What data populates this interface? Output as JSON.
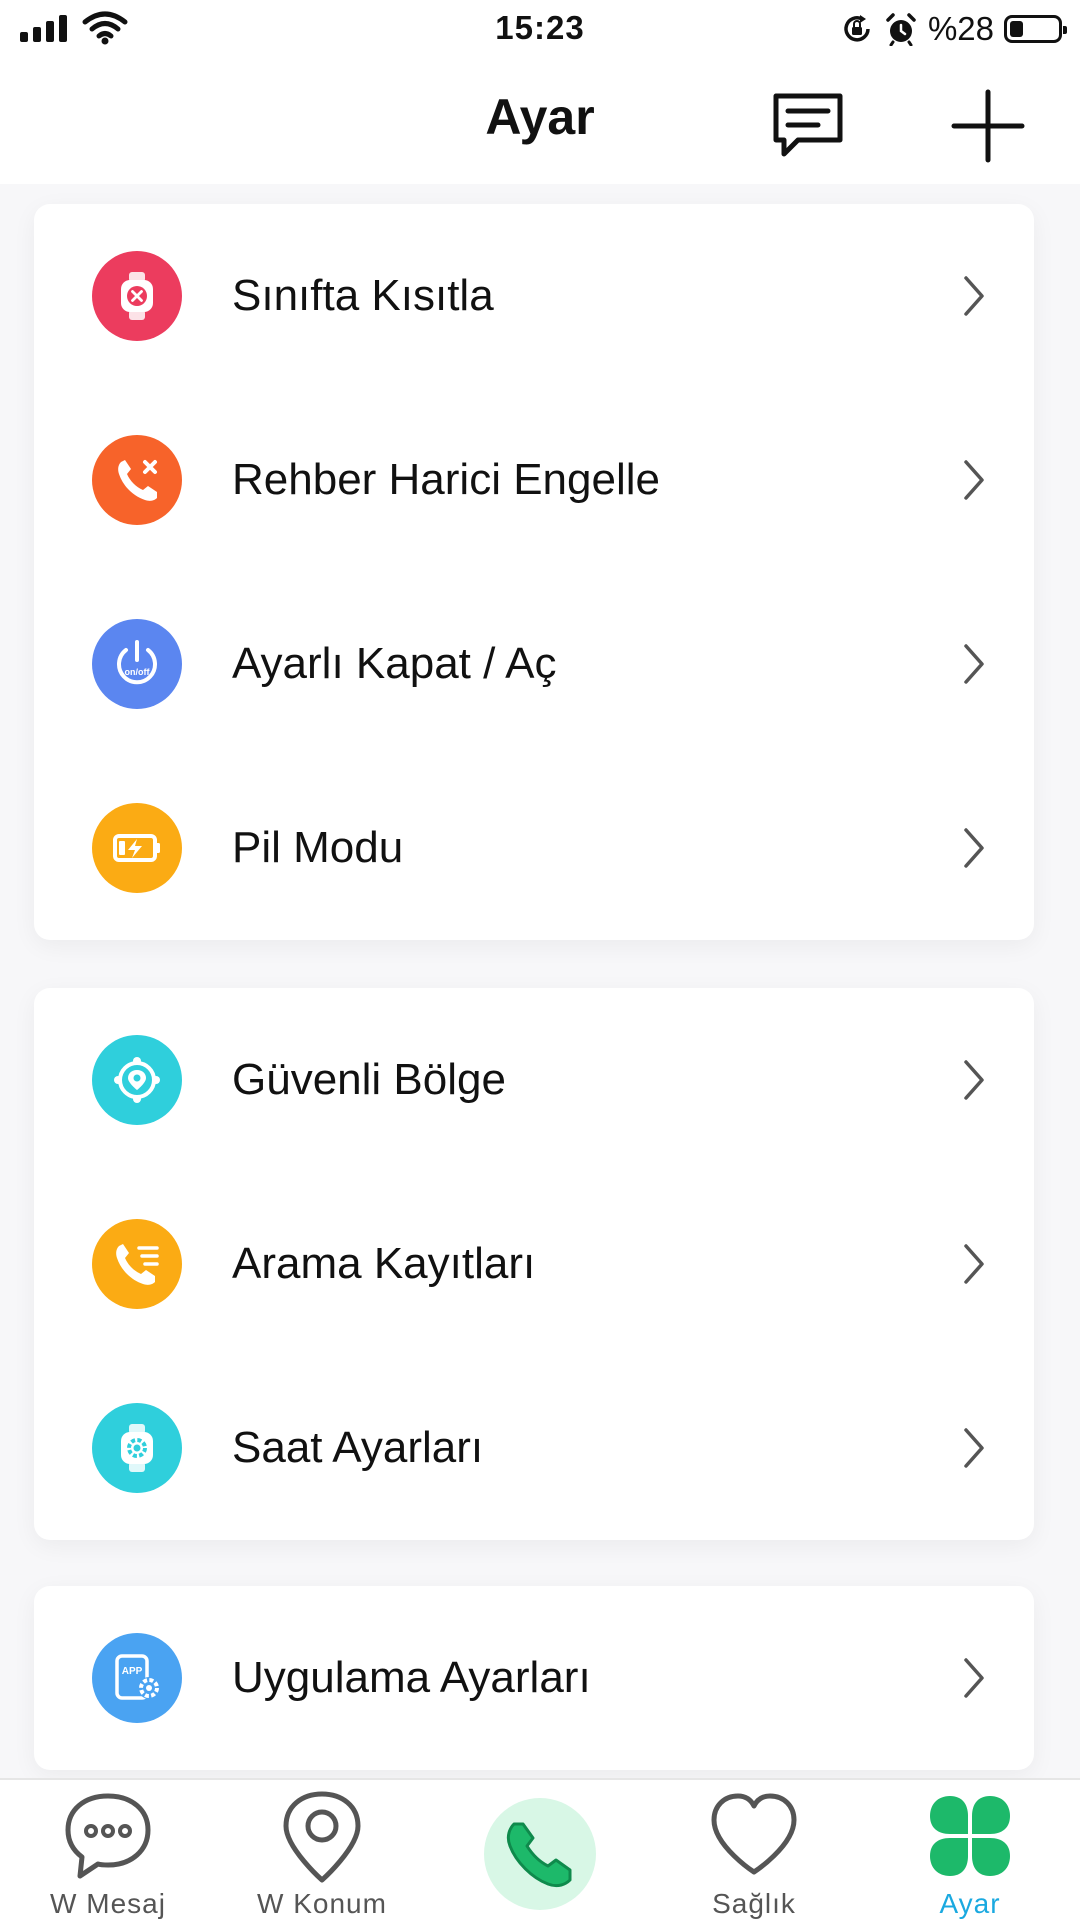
{
  "status_bar": {
    "time": "15:23",
    "battery": "%28",
    "battery_level": 0.28,
    "icons": [
      "signal-icon",
      "wifi-icon",
      "orientation-lock-icon",
      "alarm-icon",
      "battery-icon"
    ]
  },
  "header": {
    "title": "Ayar",
    "icons": [
      "message-icon",
      "plus-icon"
    ]
  },
  "groups": [
    {
      "items": [
        {
          "label": "Sınıfta Kısıtla",
          "icon": "watch-block-icon",
          "color": "#ec3c5e"
        },
        {
          "label": "Rehber Harici Engelle",
          "icon": "call-block-icon",
          "color": "#f7632a"
        },
        {
          "label": "Ayarlı Kapat / Aç",
          "icon": "power-icon",
          "color": "#5b86f0",
          "icon_text": "on/off"
        },
        {
          "label": "Pil Modu",
          "icon": "battery-charge-icon",
          "color": "#fbab14"
        }
      ]
    },
    {
      "items": [
        {
          "label": "Güvenli Bölge",
          "icon": "safe-zone-icon",
          "color": "#2fcfdc"
        },
        {
          "label": "Arama Kayıtları",
          "icon": "call-log-icon",
          "color": "#fbab14"
        },
        {
          "label": "Saat Ayarları",
          "icon": "watch-settings-icon",
          "color": "#2fcfdc"
        }
      ]
    },
    {
      "items": [
        {
          "label": "Uygulama Ayarları",
          "icon": "app-settings-icon",
          "color": "#4aa3f2",
          "icon_text": "APP"
        }
      ]
    }
  ],
  "tabbar": {
    "tabs": [
      {
        "label": "W Mesaj",
        "icon": "chat-bubble-icon"
      },
      {
        "label": "W Konum",
        "icon": "location-pin-icon"
      },
      {
        "label": "",
        "icon": "phone-icon"
      },
      {
        "label": "Sağlık",
        "icon": "heart-icon"
      },
      {
        "label": "Ayar",
        "icon": "clover-icon",
        "active": true
      }
    ],
    "active_color": "#1aa9e0",
    "active_icon_color": "#1db96a"
  }
}
